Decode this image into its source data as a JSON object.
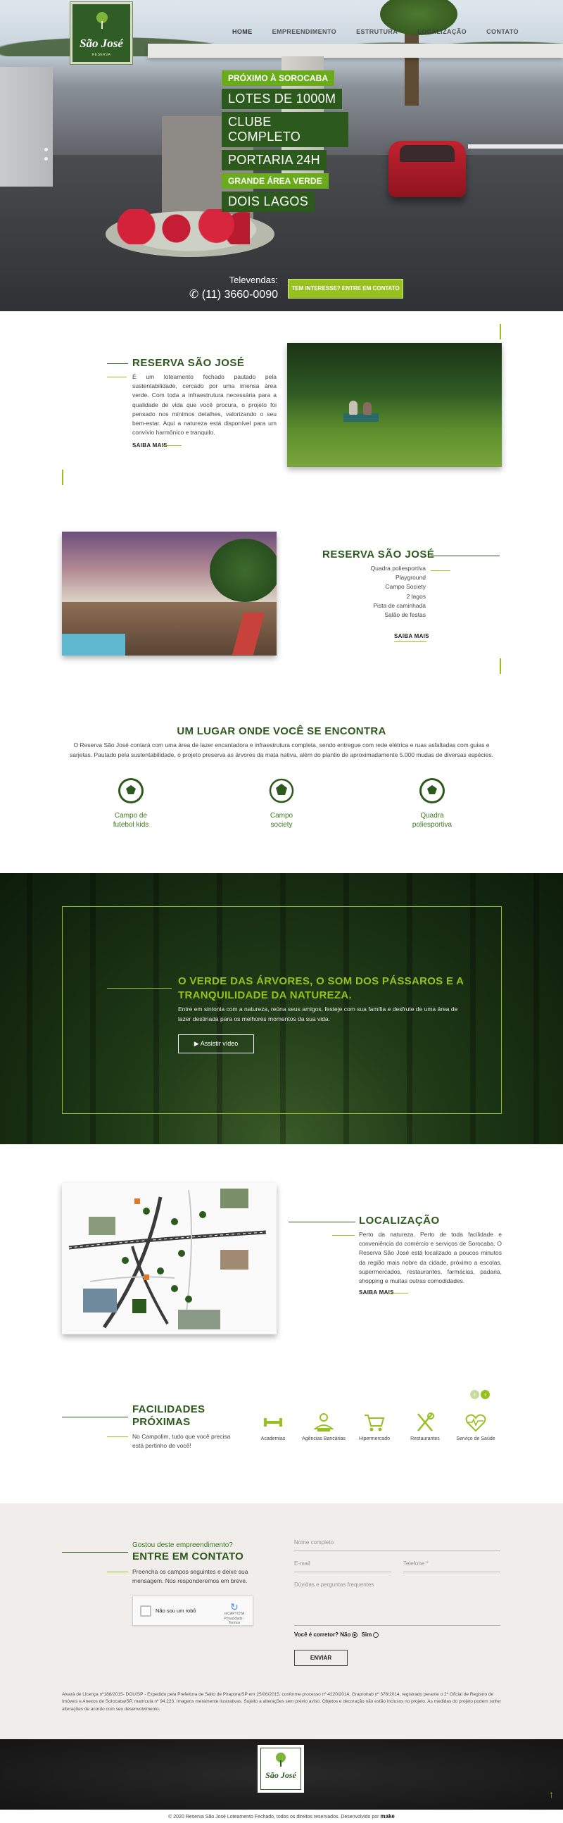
{
  "brand": {
    "logo_text": "São José",
    "logo_sub": "RESERVA",
    "accent": "#97c11f",
    "dark_green": "#2c5a1c"
  },
  "nav": {
    "items": [
      {
        "label": "HOME",
        "active": true
      },
      {
        "label": "EMPREENDIMENTO",
        "active": false
      },
      {
        "label": "ESTRUTURA",
        "active": false
      },
      {
        "label": "LOCALIZAÇÃO",
        "active": false
      },
      {
        "label": "CONTATO",
        "active": false
      }
    ]
  },
  "hero": {
    "tags": [
      {
        "text": "PRÓXIMO À SOROCABA",
        "style": "lime"
      },
      {
        "text": "LOTES DE 1000M",
        "style": "dark"
      },
      {
        "text": "CLUBE COMPLETO",
        "style": "dark"
      },
      {
        "text": "PORTARIA 24H",
        "style": "dark"
      },
      {
        "text": "GRANDE ÁREA VERDE",
        "style": "lime"
      },
      {
        "text": "DOIS LAGOS",
        "style": "dark"
      }
    ],
    "televendas_label": "Televendas:",
    "phone": "(11) 3660-0090",
    "cta": "TEM INTERESSE? ENTRE EM CONTATO"
  },
  "about": {
    "title": "RESERVA SÃO JOSÉ",
    "text": "É um loteamento fechado pautado pela sustentabilidade, cercado por uma imensa área verde. Com toda a infraestrutura necessária para a qualidade de vida que você procura, o projeto foi pensado nos mínimos detalhes, valorizando o seu bem-estar. Aqui a natureza está disponível para um convívio harmônico e tranquilo.",
    "link": "SAIBA MAIS"
  },
  "structure": {
    "title": "RESERVA SÃO JOSÉ",
    "items": [
      "Quadra poliesportiva",
      "Playground",
      "Campo Society",
      "2 lagos",
      "Pista de caminhada",
      "Salão de festas"
    ],
    "link": "SAIBA MAIS"
  },
  "lugar": {
    "title": "UM LUGAR ONDE VOCÊ SE ENCONTRA",
    "text": "O Reserva São José contará com uma área de lazer encantadora e infraestrutura completa, sendo entregue com rede elétrica e ruas asfaltadas com guias e sarjetas. Pautado pela sustentabilidade, o projeto preserva as árvores da mata nativa, além do plantio de aproximadamente 5.000 mudas de diversas espécies.",
    "amenities": [
      {
        "line1": "Campo de",
        "line2": "futebol kids"
      },
      {
        "line1": "Campo",
        "line2": "society"
      },
      {
        "line1": "Quadra",
        "line2": "poliesportiva"
      }
    ]
  },
  "forest": {
    "title_line1": "O VERDE DAS ÁRVORES, O SOM DOS PÁSSAROS E A",
    "title_line2": "TRANQUILIDADE DA NATUREZA.",
    "text": "Entre em sintonia com a natureza, reúna seus amigos, festeje com sua família e desfrute de uma área de lazer destinada para os melhores momentos da sua vida.",
    "video": "Assistir vídeo"
  },
  "localizacao": {
    "title": "LOCALIZAÇÃO",
    "text": "Perto da natureza. Perto de toda facilidade e conveniência do comércio e serviços de Sorocaba. O Reserva São José está localizado a poucos minutos da região mais nobre da cidade, próximo a escolas, supermercados, restaurantes, farmácias, padaria, shopping e muitas outras comodidades.",
    "link": "SAIBA MAIS"
  },
  "facilidades": {
    "title_line1": "FACILIDADES",
    "title_line2": "PRÓXIMAS",
    "text": "No Campolim, tudo que você precisa está pertinho de você!",
    "items": [
      "Academias",
      "Agências Bancárias",
      "Hipermercado",
      "Restaurantes",
      "Serviço de Saúde"
    ]
  },
  "contato": {
    "pre": "Gostou deste empreendimento?",
    "title": "ENTRE EM CONTATO",
    "text": "Preencha os campos seguintes e deixe sua mensagem. Nos responderemos em breve.",
    "recaptcha": "Não sou um robô",
    "recaptcha_brand": "reCAPTCHA",
    "recaptcha_links": "Privacidade - Termos",
    "placeholders": {
      "nome": "Nome completo",
      "email": "E-mail",
      "telefone": "Telefone *",
      "mensagem": "Dúvidas e perguntas frequentes"
    },
    "correct_q": "Você é corretor?",
    "nao": "Não",
    "sim": "Sim",
    "enviar": "ENVIAR"
  },
  "legal": "Alvará de Licença nº188/2015- DOU/SP - Expedido pela Prefeitura de Salto de Pirapora/SP em 25/06/2015, conforme processo nº 4220/2014, Graprohab nº 376/2014, registrado perante o 2º Oficial de Registro de Imóveis e Anexos de Sorocaba/SP, matrícula nº 94.223. Imagens meramente ilustrativas. Sujeito a alterações sem prévio aviso. Objetos e decoração não estão inclusos no projeto. As medidas do projeto podem sofrer alterações de acordo com seu desenvolvimento.",
  "footer": {
    "copyright": "© 2020 Reserva São José Loteamento Fechado, todos os direitos reservados. Desenvolvido por",
    "dev": "make"
  }
}
